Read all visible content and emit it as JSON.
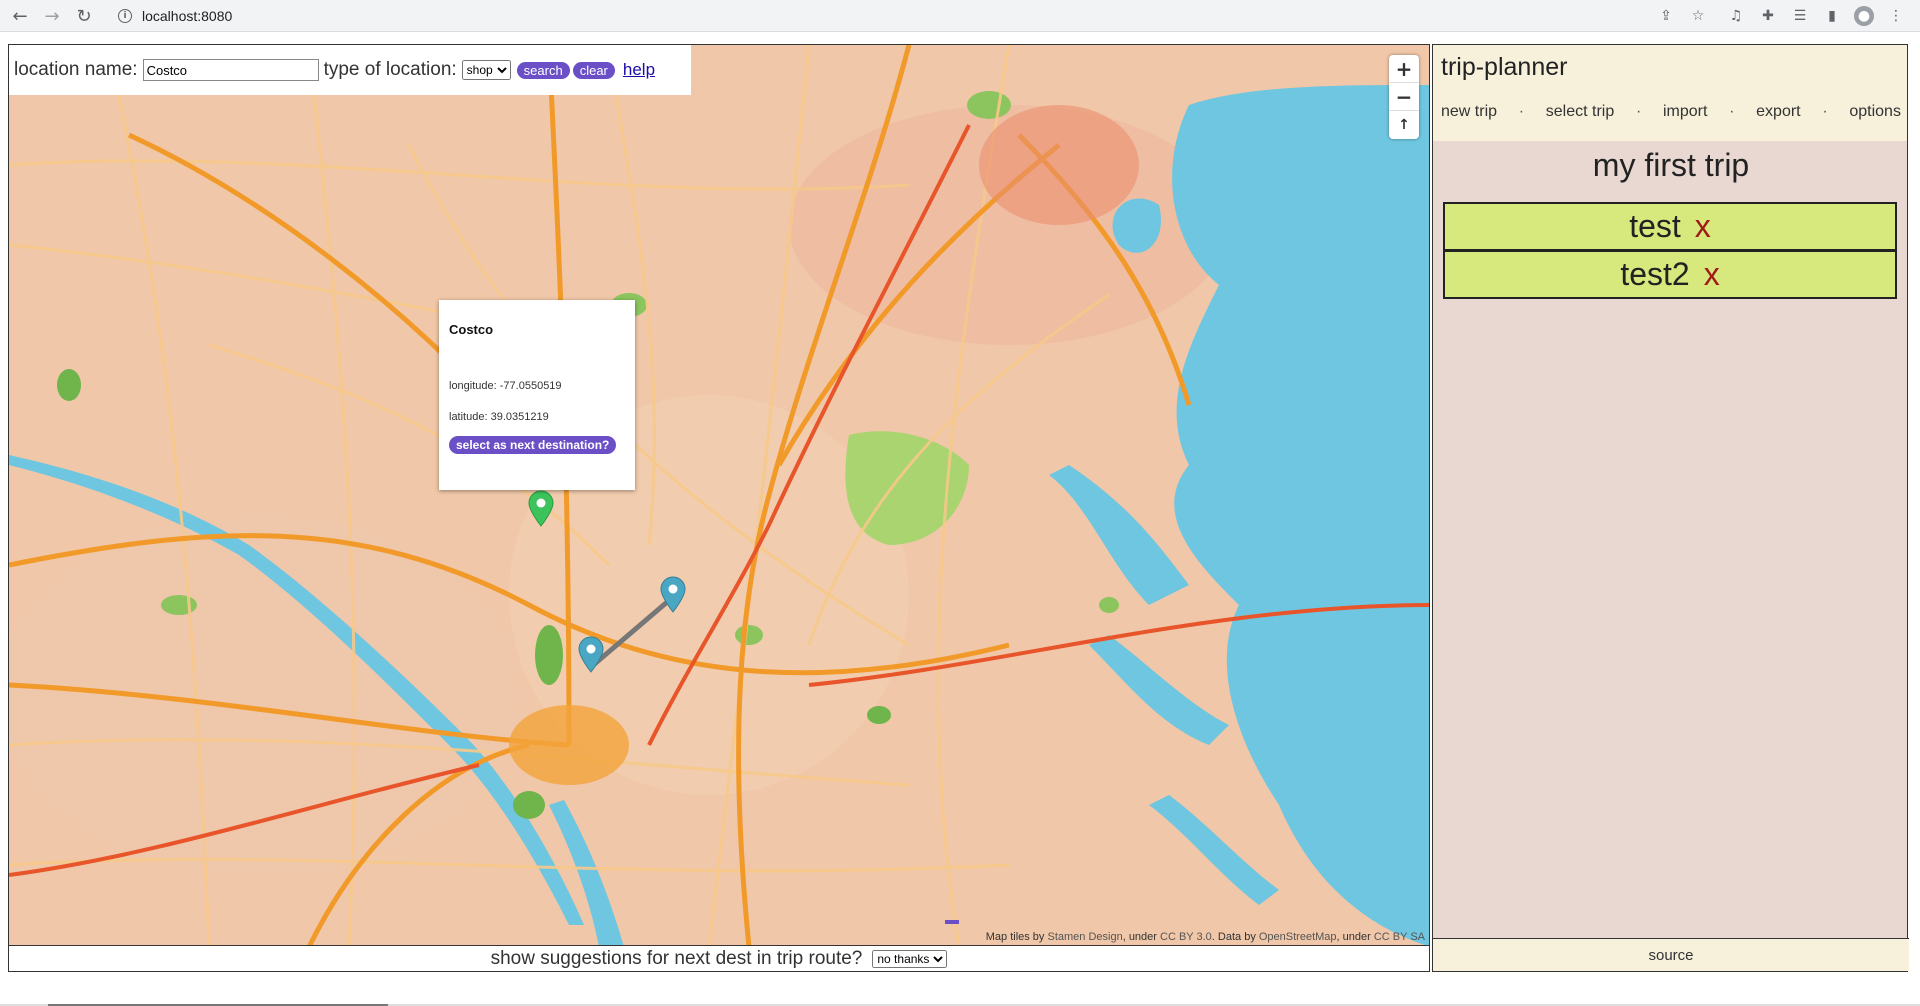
{
  "browser": {
    "url": "localhost:8080",
    "icons": [
      "back-icon",
      "forward-icon",
      "reload-icon",
      "info-icon",
      "share-icon",
      "star-icon",
      "music-icon",
      "puzzle-icon",
      "reading-list-icon",
      "sidepanel-icon",
      "profile-icon",
      "menu-icon"
    ]
  },
  "search": {
    "location_label": "location name:",
    "location_value": "Costco",
    "type_label": "type of location:",
    "type_value": "shop",
    "search_label": "search",
    "clear_label": "clear",
    "help_label": "help"
  },
  "map": {
    "zoom_in": "+",
    "zoom_out": "−",
    "reset_north": "↑",
    "popup": {
      "title": "Costco",
      "longitude": "longitude: -77.0550519",
      "latitude": "latitude: 39.0351219",
      "button": "select as next destination?"
    },
    "attribution": {
      "p1": "Map tiles by ",
      "l1": "Stamen Design",
      "p2": ", under ",
      "l2": "CC BY 3.0",
      "p3": ". Data by ",
      "l3": "OpenStreetMap",
      "p4": ", under ",
      "l4": "CC BY SA"
    },
    "colors": {
      "land": "#f0c7a8",
      "water": "#6fc6e0",
      "park": "#a9d46f",
      "major_road": "#f19a2a",
      "minor_road": "#f7c98a",
      "route_line": "#777777",
      "marker_blue": "#4aa7c4",
      "marker_green": "#3cc35b"
    }
  },
  "suggest": {
    "label": "show suggestions for next dest in trip route?",
    "value": "no thanks"
  },
  "panel": {
    "title": "trip-planner",
    "nav": [
      "new trip",
      "select trip",
      "import",
      "export",
      "options"
    ],
    "separator": "·",
    "trip_name": "my first trip",
    "destinations": [
      {
        "name": "test",
        "remove": "x"
      },
      {
        "name": "test2",
        "remove": "x"
      }
    ],
    "footer": "source"
  }
}
